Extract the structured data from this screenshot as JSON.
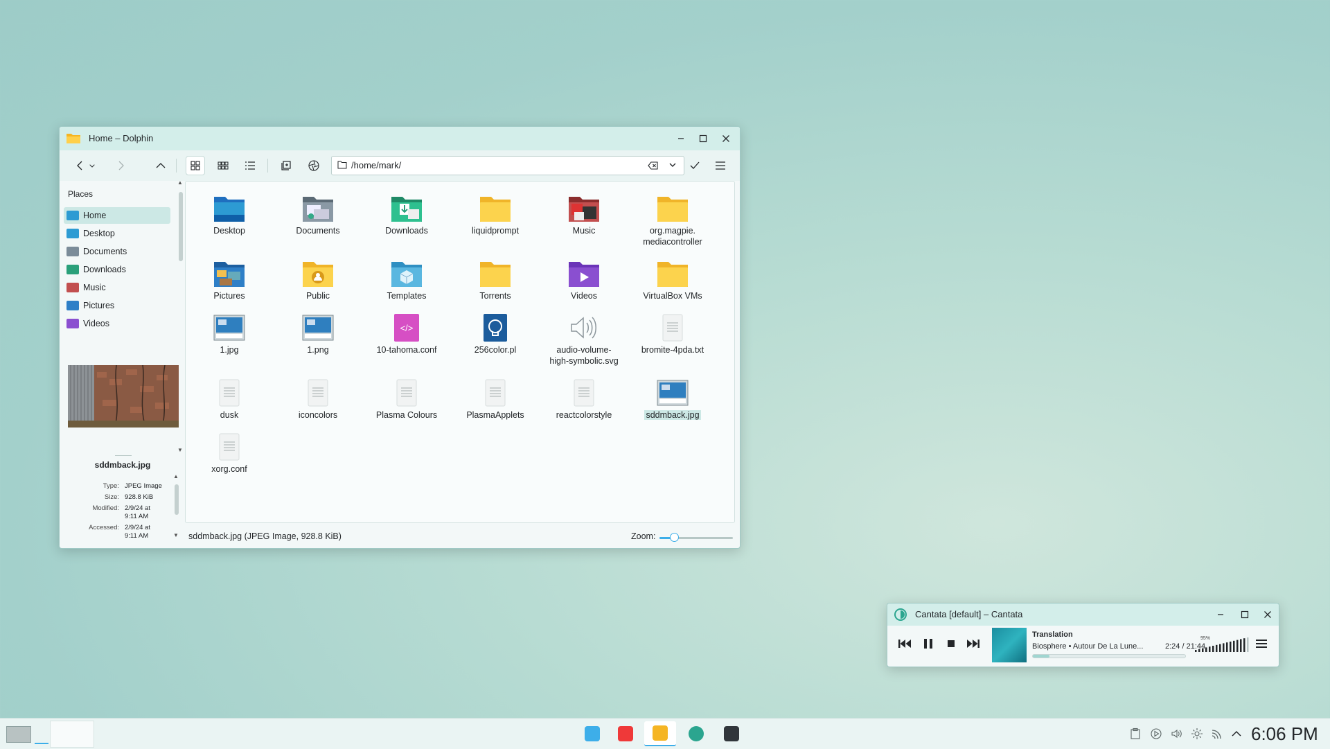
{
  "dolphin": {
    "title": "Home – Dolphin",
    "address": "/home/mark/",
    "places_header": "Places",
    "places": [
      {
        "label": "Home",
        "color": "#2d9bd3",
        "selected": true
      },
      {
        "label": "Desktop",
        "color": "#2d9bd3"
      },
      {
        "label": "Documents",
        "color": "#7b8c99"
      },
      {
        "label": "Downloads",
        "color": "#2aa07a"
      },
      {
        "label": "Music",
        "color": "#c24f4f"
      },
      {
        "label": "Pictures",
        "color": "#2e7fc7"
      },
      {
        "label": "Videos",
        "color": "#8a4fd0"
      }
    ],
    "items": [
      {
        "name": "Desktop",
        "icon": "folder-desktop-icon"
      },
      {
        "name": "Documents",
        "icon": "folder-documents-icon"
      },
      {
        "name": "Downloads",
        "icon": "folder-downloads-icon"
      },
      {
        "name": "liquidprompt",
        "icon": "folder-icon"
      },
      {
        "name": "Music",
        "icon": "folder-music-icon"
      },
      {
        "name": "org.magpie.\nmediacontroller",
        "icon": "folder-icon"
      },
      {
        "name": "Pictures",
        "icon": "folder-pictures-icon"
      },
      {
        "name": "Public",
        "icon": "folder-public-icon"
      },
      {
        "name": "Templates",
        "icon": "folder-templates-icon"
      },
      {
        "name": "Torrents",
        "icon": "folder-icon"
      },
      {
        "name": "Videos",
        "icon": "folder-videos-icon"
      },
      {
        "name": "VirtualBox VMs",
        "icon": "folder-icon"
      },
      {
        "name": "1.jpg",
        "icon": "image-thumbnail-icon"
      },
      {
        "name": "1.png",
        "icon": "image-thumbnail-icon"
      },
      {
        "name": "10-tahoma.conf",
        "icon": "code-file-icon"
      },
      {
        "name": "256color.pl",
        "icon": "perl-script-icon"
      },
      {
        "name": "audio-volume-\nhigh-symbolic.svg",
        "icon": "speaker-icon"
      },
      {
        "name": "bromite-4pda.txt",
        "icon": "text-file-icon"
      },
      {
        "name": "dusk",
        "icon": "text-file-icon"
      },
      {
        "name": "iconcolors",
        "icon": "text-file-icon"
      },
      {
        "name": "Plasma Colours",
        "icon": "text-file-icon"
      },
      {
        "name": "PlasmaApplets",
        "icon": "text-file-icon"
      },
      {
        "name": "reactcolorstyle",
        "icon": "text-file-icon"
      },
      {
        "name": "sddmback.jpg",
        "icon": "image-thumbnail-icon",
        "selected": true
      },
      {
        "name": "xorg.conf",
        "icon": "text-file-icon"
      }
    ],
    "info_panel": {
      "file_name": "sddmback.jpg",
      "rows": [
        {
          "key": "Type:",
          "value": "JPEG Image"
        },
        {
          "key": "Size:",
          "value": "928.8 KiB"
        },
        {
          "key": "Modified:",
          "value": "2/9/24 at\n9:11 AM"
        },
        {
          "key": "Accessed:",
          "value": "2/9/24 at\n9:11 AM"
        }
      ]
    },
    "status_text": "sddmback.jpg (JPEG Image, 928.8 KiB)",
    "zoom_label": "Zoom:",
    "zoom_fraction": 0.2
  },
  "cantata": {
    "title": "Cantata [default] – Cantata",
    "track_title": "Translation",
    "track_info": "Biosphere • Autour De La Lune...",
    "time": "2:24 / 21:44",
    "progress_fraction": 0.11,
    "volume_label": "95%",
    "volume_fraction": 0.95
  },
  "taskbar": {
    "clock": "6:06 PM",
    "apps": [
      {
        "name": "kde-connect-icon",
        "color": "#3daee9"
      },
      {
        "name": "vivaldi-icon",
        "color": "#ef3939"
      },
      {
        "name": "dolphin-icon",
        "color": "#f5b523",
        "active": true
      },
      {
        "name": "cantata-icon",
        "color": "#2ba58f"
      },
      {
        "name": "terminal-icon",
        "color": "#31363b"
      }
    ],
    "tray": [
      "clipboard-icon",
      "media-player-icon",
      "volume-icon",
      "brightness-icon",
      "network-icon",
      "expand-tray-icon"
    ]
  },
  "colors": {
    "accent": "#3daee9",
    "selection": "#cce8e5",
    "folder_yellow": "#fcc935"
  }
}
